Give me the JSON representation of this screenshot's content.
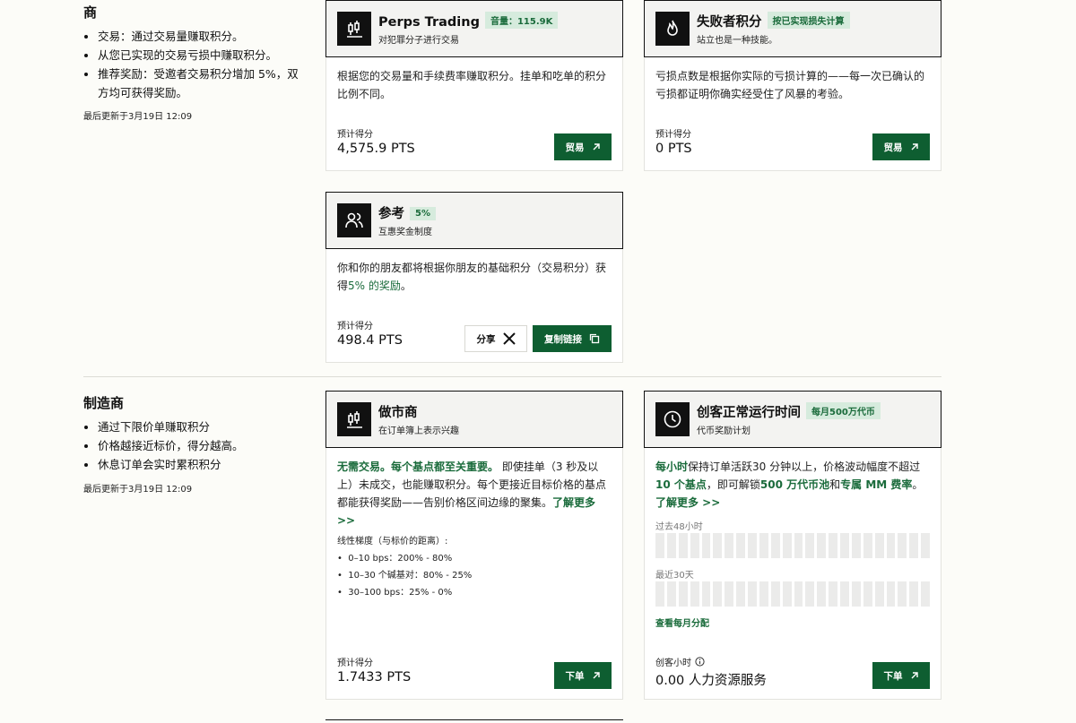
{
  "taker": {
    "title": "商",
    "bullets": [
      "交易：通过交易量赚取积分。",
      "从您已实现的交易亏损中赚取积分。",
      "推荐奖励：受邀者交易积分增加 5%，双方均可获得奖励。"
    ],
    "updated": "最后更新于3月19日 12:09"
  },
  "maker": {
    "title": "制造商",
    "bullets": [
      "通过下限价单赚取积分",
      "价格越接近标价，得分越高。",
      "休息订单会实时累积积分"
    ],
    "updated": "最后更新于3月19日 12:09"
  },
  "estimate_label": "预计得分",
  "cards": {
    "perps": {
      "title": "Perps Trading",
      "badge": "音量：115.9K",
      "subtitle": "对犯罪分子进行交易",
      "desc": "根据您的交易量和手续费率赚取积分。挂单和吃单的积分比例不同。",
      "pts": "4,575.9 PTS",
      "button": "贸易",
      "icon": "candlestick-icon"
    },
    "loser": {
      "title": "失败者积分",
      "badge": "按已实现损失计算",
      "subtitle": "站立也是一种技能。",
      "desc": "亏损点数是根据你实际的亏损计算的——每一次已确认的亏损都证明你确实经受住了风暴的考验。",
      "pts": "0 PTS",
      "button": "贸易",
      "icon": "flame-icon"
    },
    "referral": {
      "title": "参考",
      "badge": "5%",
      "subtitle": "互惠奖金制度",
      "desc_a": "你和你的朋友都将根据你朋友的基础积分（交易积分）获得",
      "desc_b": "5% 的奖励",
      "desc_c": "。",
      "pts": "498.4 PTS",
      "share": "分享",
      "copy": "复制链接",
      "icon": "users-icon"
    },
    "mm": {
      "title": "做市商",
      "subtitle": "在订单簿上表示兴趣",
      "desc_a": "无需交易。每个基点都至关重要。",
      "desc_b": "即使挂单（3 秒及以上）未成交，也能赚取积分。每个更接近目标价格的基点都能获得奖励——告别价格区间边缘的聚集。",
      "desc_link": "了解更多 >>",
      "tiers_title": "线性梯度（与标价的距离）:",
      "tiers": [
        "0–10 bps：200% - 80%",
        "10–30 个碱基对：80% - 25%",
        "30–100 bps：25% - 0%"
      ],
      "pts": "1.7433 PTS",
      "button": "下单",
      "icon": "candlestick-icon"
    },
    "uptime": {
      "title": "创客正常运行时间",
      "badge": "每月500万代币",
      "subtitle": "代币奖励计划",
      "desc_1": "每小时",
      "desc_2": "保持订单活跃30 分钟以上，价格波动幅度不超过",
      "desc_3": "10 个基点",
      "desc_4": "，即可解锁",
      "desc_5": "500 万代币池",
      "desc_6": "和",
      "desc_7": "专属 MM 费率",
      "desc_8": "。",
      "desc_link": "了解更多 >>",
      "label_48h": "过去48小时",
      "label_30d": "最近30天",
      "monthly_link": "查看每月分配",
      "hours_label": "创客小时",
      "pts": "0.00 人力资源服务",
      "button": "下单",
      "icon": "clock-icon"
    }
  }
}
